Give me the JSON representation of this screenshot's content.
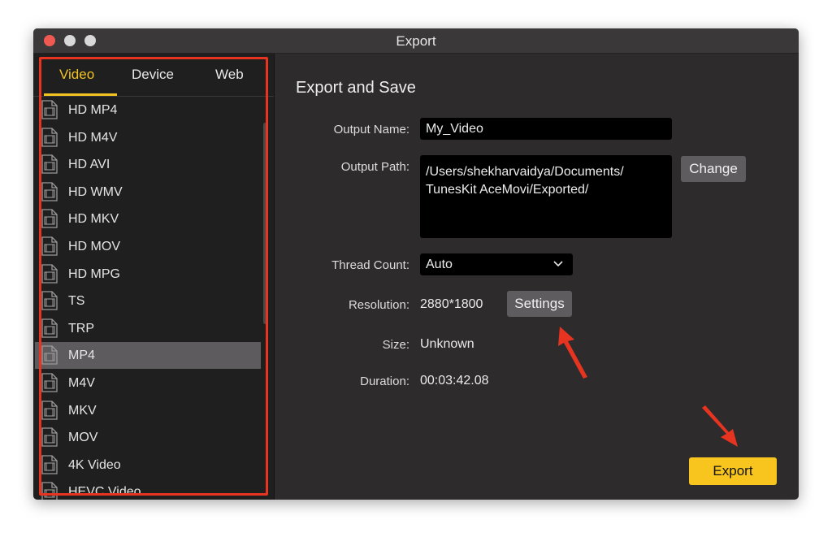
{
  "window": {
    "title": "Export"
  },
  "sidebar": {
    "tabs": [
      {
        "label": "Video",
        "active": true
      },
      {
        "label": "Device",
        "active": false
      },
      {
        "label": "Web",
        "active": false
      }
    ],
    "formats": [
      "HD MP4",
      "HD M4V",
      "HD AVI",
      "HD WMV",
      "HD MKV",
      "HD MOV",
      "HD MPG",
      "TS",
      "TRP",
      "MP4",
      "M4V",
      "MKV",
      "MOV",
      "4K Video",
      "HEVC Video"
    ],
    "selected_index": 9
  },
  "panel": {
    "title": "Export and Save",
    "output_name_label": "Output Name:",
    "output_name_value": "My_Video",
    "output_path_label": "Output Path:",
    "output_path_line1": "/Users/shekharvaidya/Documents/",
    "output_path_line2": "TunesKit AceMovi/Exported/",
    "change_button": "Change",
    "thread_count_label": "Thread Count:",
    "thread_count_value": "Auto",
    "resolution_label": "Resolution:",
    "resolution_value": "2880*1800",
    "settings_button": "Settings",
    "size_label": "Size:",
    "size_value": "Unknown",
    "duration_label": "Duration:",
    "duration_value": "00:03:42.08",
    "export_button": "Export"
  },
  "colors": {
    "accent": "#f2c321",
    "annotation": "#e63420",
    "export_button": "#f7c51e"
  },
  "icons": [
    "close-dot",
    "film-file-icon",
    "chevron-down-icon",
    "annotation-arrow"
  ]
}
